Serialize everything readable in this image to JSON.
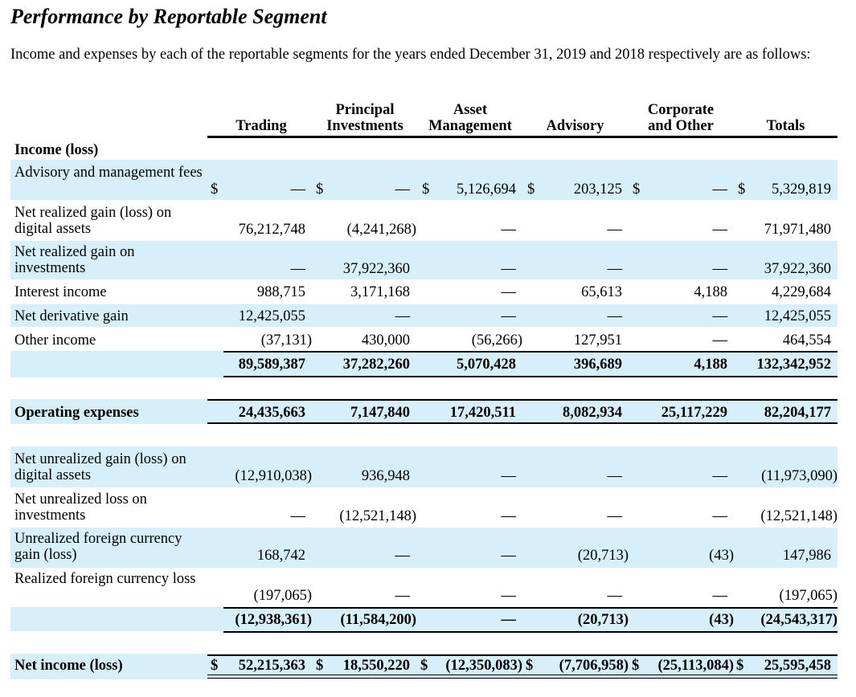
{
  "title": "Performance by Reportable Segment",
  "intro": "Income and expenses by each of the reportable segments for the years ended December 31, 2019 and 2018 respectively are as follows:",
  "columns": [
    {
      "line1": "",
      "line2": "Trading"
    },
    {
      "line1": "Principal",
      "line2": "Investments"
    },
    {
      "line1": "Asset",
      "line2": "Management"
    },
    {
      "line1": "",
      "line2": "Advisory"
    },
    {
      "line1": "Corporate",
      "line2": "and Other"
    },
    {
      "line1": "",
      "line2": "Totals"
    }
  ],
  "income_header": "Income (loss)",
  "rows": {
    "advisory_fees": {
      "label": "Advisory and management fees",
      "values": [
        "—",
        "—",
        "5,126,694",
        "203,125",
        "—",
        "5,329,819"
      ]
    },
    "realized_digital": {
      "label": "Net realized gain (loss) on digital assets",
      "values": [
        "76,212,748",
        "(4,241,268)",
        "—",
        "—",
        "—",
        "71,971,480"
      ]
    },
    "realized_invest": {
      "label": "Net realized gain on investments",
      "values": [
        "—",
        "37,922,360",
        "—",
        "—",
        "—",
        "37,922,360"
      ]
    },
    "interest": {
      "label": "Interest income",
      "values": [
        "988,715",
        "3,171,168",
        "—",
        "65,613",
        "4,188",
        "4,229,684"
      ]
    },
    "derivative": {
      "label": "Net derivative gain",
      "values": [
        "12,425,055",
        "—",
        "—",
        "—",
        "—",
        "12,425,055"
      ]
    },
    "other_income": {
      "label": "Other income",
      "values": [
        "(37,131)",
        "430,000",
        "(56,266)",
        "127,951",
        "—",
        "464,554"
      ]
    },
    "income_total": {
      "label": "",
      "values": [
        "89,589,387",
        "37,282,260",
        "5,070,428",
        "396,689",
        "4,188",
        "132,342,952"
      ]
    },
    "opex": {
      "label": "Operating expenses",
      "values": [
        "24,435,663",
        "7,147,840",
        "17,420,511",
        "8,082,934",
        "25,117,229",
        "82,204,177"
      ]
    },
    "unreal_digital": {
      "label": "Net unrealized gain (loss) on digital assets",
      "values": [
        "(12,910,038)",
        "936,948",
        "—",
        "—",
        "—",
        "(11,973,090)"
      ]
    },
    "unreal_invest": {
      "label": "Net unrealized loss on investments",
      "values": [
        "—",
        "(12,521,148)",
        "—",
        "—",
        "—",
        "(12,521,148)"
      ]
    },
    "unreal_fx": {
      "label": "Unrealized foreign currency gain (loss)",
      "values": [
        "168,742",
        "—",
        "—",
        "(20,713)",
        "(43)",
        "147,986"
      ]
    },
    "real_fx": {
      "label": "Realized foreign currency loss",
      "values": [
        "(197,065)",
        "—",
        "—",
        "—",
        "—",
        "(197,065)"
      ]
    },
    "other_total": {
      "label": "",
      "values": [
        "(12,938,361)",
        "(11,584,200)",
        "—",
        "(20,713)",
        "(43)",
        "(24,543,317)"
      ]
    },
    "net_income": {
      "label": "Net income (loss)",
      "values": [
        "52,215,363",
        "18,550,220",
        "(12,350,083)",
        "(7,706,958)",
        "(25,113,084)",
        "25,595,458"
      ]
    }
  },
  "currency_symbol": "$",
  "colors": {
    "band": "#d6effb"
  }
}
